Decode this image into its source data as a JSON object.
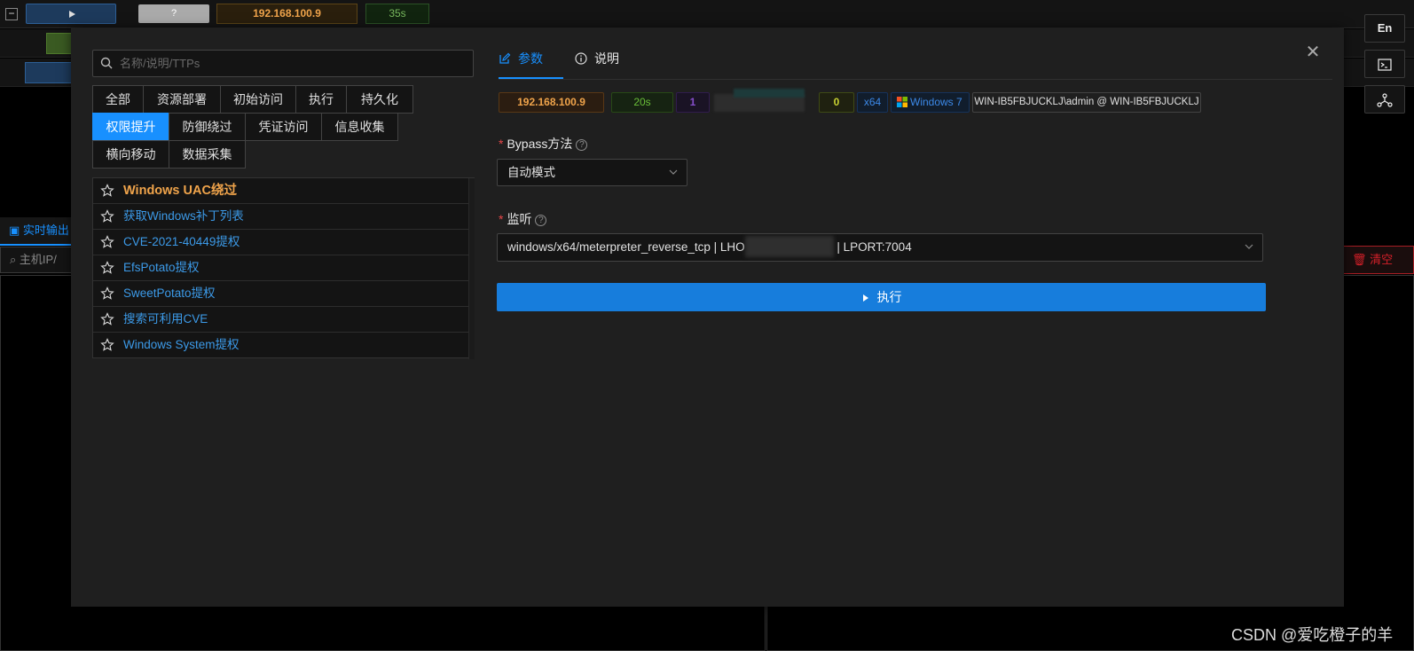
{
  "topbar": {
    "ip": "192.168.100.9",
    "time": "35s",
    "unknown": "?",
    "collapse": "−"
  },
  "right_buttons": {
    "lang": "En"
  },
  "background": {
    "live_tab": "实时输出",
    "host_search": "主机IP/",
    "clear": "清空"
  },
  "modal": {
    "search_placeholder": "名称/说明/TTPs",
    "categories": [
      "全部",
      "资源部署",
      "初始访问",
      "执行",
      "持久化",
      "权限提升",
      "防御绕过",
      "凭证访问",
      "信息收集",
      "横向移动",
      "数据采集"
    ],
    "active_category": "权限提升",
    "modules": [
      "Windows UAC绕过",
      "获取Windows补丁列表",
      "CVE-2021-40449提权",
      "EfsPotato提权",
      "SweetPotato提权",
      "搜索可利用CVE",
      "Windows System提权"
    ],
    "tabs": {
      "params": "参数",
      "description": "说明"
    },
    "session_tags": {
      "ip": "192.168.100.9",
      "time": "20s",
      "count": "1",
      "zero": "0",
      "arch": "x64",
      "os": "Windows 7",
      "user": "WIN-IB5FBJUCKLJ\\admin @ WIN-IB5FBJUCKLJ"
    },
    "bypass": {
      "label": "Bypass方法",
      "value": "自动模式"
    },
    "listener": {
      "label": "监听",
      "value_prefix": "windows/x64/meterpreter_reverse_tcp | LHO",
      "value_suffix": "| LPORT:7004"
    },
    "execute": "执行"
  },
  "watermark": "CSDN @爱吃橙子的羊",
  "colors": {
    "accent": "#1890ff",
    "orange": "#f0a44b",
    "green": "#77b85d",
    "purple": "#9a6ce0",
    "yellow": "#c0cb35"
  }
}
